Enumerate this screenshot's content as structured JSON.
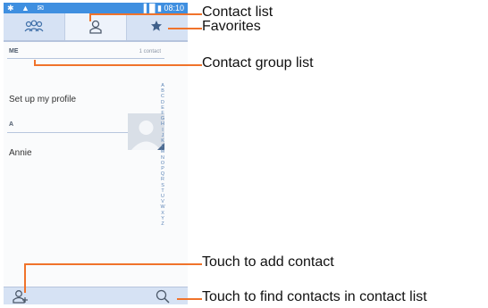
{
  "status_bar": {
    "left_icons": "✱ ▲ ✉",
    "time": "08:10"
  },
  "tabs": [
    {
      "name": "contact-group-tab"
    },
    {
      "name": "contact-list-tab",
      "selected": true
    },
    {
      "name": "favorites-tab"
    }
  ],
  "list": {
    "me_header": "ME",
    "me_count": "1 contact",
    "profile_item": "Set up my profile",
    "a_header": "A",
    "contact": "Annie"
  },
  "alphabet": [
    "A",
    "B",
    "C",
    "D",
    "E",
    "F",
    "G",
    "H",
    "I",
    "J",
    "K",
    "L",
    "M",
    "N",
    "O",
    "P",
    "Q",
    "R",
    "S",
    "T",
    "U",
    "V",
    "W",
    "X",
    "Y",
    "Z"
  ],
  "callouts": {
    "contact_list": "Contact list",
    "favorites": "Favorites",
    "group_list": "Contact group list",
    "add_contact": "Touch to add contact",
    "find_contacts": "Touch to find contacts in contact list"
  },
  "colors": {
    "accent": "#f0732b",
    "status_bar": "#3f8fe0",
    "tab_bar": "#d6e2f4"
  }
}
